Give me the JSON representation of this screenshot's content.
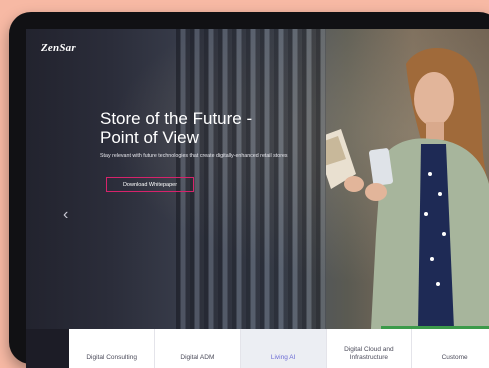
{
  "brand": {
    "logo_text": "ZenSar"
  },
  "hero": {
    "title_line1": "Store of the Future -",
    "title_line2": "Point of View",
    "subtitle": "Stay relevant with future technologies that create digitally-enhanced retail stores",
    "cta_label": "Download Whitepaper",
    "accent_color": "#d6236b"
  },
  "carousel": {
    "prev_icon": "chevron-left-icon",
    "slide_count": 5,
    "active_index": 2
  },
  "tabs": [
    {
      "label": "Digital Consulting",
      "active": false
    },
    {
      "label": "Digital ADM",
      "active": false
    },
    {
      "label": "Living AI",
      "active": true
    },
    {
      "label": "Digital Cloud and Infrastructure",
      "active": false
    },
    {
      "label": "Custome",
      "active": false
    }
  ]
}
